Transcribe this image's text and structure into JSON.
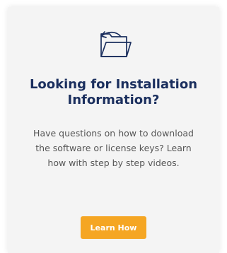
{
  "card": {
    "title": "Looking for Installation Information?",
    "description": "Have questions on how to download the software or license keys? Learn how with step by step videos.",
    "button_label": "Learn How",
    "icon": "folder-arrow-icon"
  },
  "colors": {
    "title": "#1b2f5e",
    "button": "#f5a623",
    "card_background": "#f4f4f4"
  }
}
